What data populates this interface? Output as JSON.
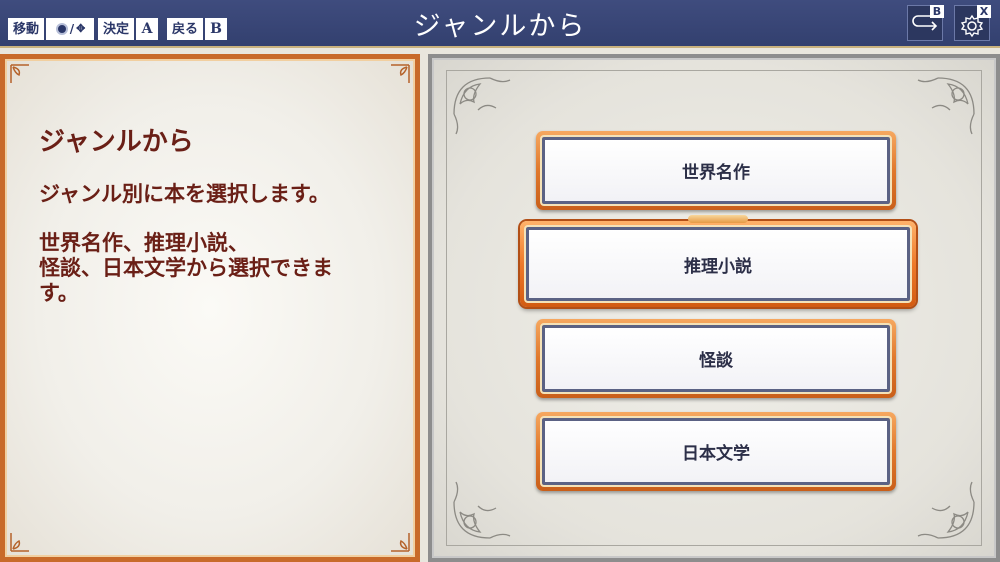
{
  "header": {
    "title": "ジャンルから",
    "hints": {
      "move_label": "移動",
      "move_key_slash": "/",
      "decide_label": "決定",
      "decide_key": "A",
      "back_label": "戻る",
      "back_key": "B"
    },
    "back_button_key": "B",
    "settings_button_key": "X"
  },
  "description": {
    "title": "ジャンルから",
    "line1": "ジャンル別に本を選択します。",
    "line2": "世界名作、推理小説、\n怪談、日本文学から選択できま\nす。"
  },
  "genres": [
    {
      "label": "世界名作",
      "selected": false
    },
    {
      "label": "推理小説",
      "selected": true
    },
    {
      "label": "怪談",
      "selected": false
    },
    {
      "label": "日本文学",
      "selected": false
    }
  ],
  "colors": {
    "topbar": "#3a4676",
    "accent_orange": "#e0782c",
    "text_maroon": "#6a1f16"
  },
  "icons": {
    "move": "analog-stick-and-dpad-icon",
    "back": "return-arrow-icon",
    "settings": "gear-icon"
  }
}
